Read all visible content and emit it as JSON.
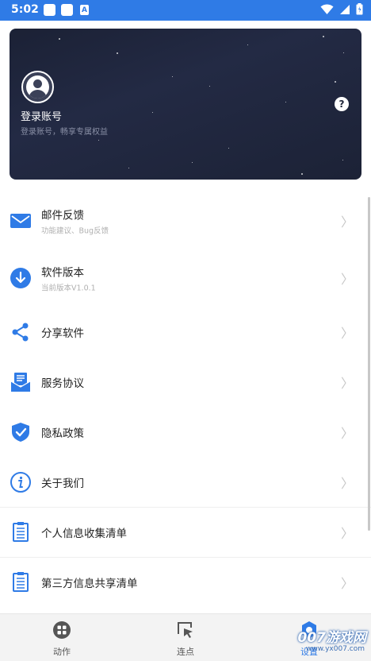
{
  "status_bar": {
    "time": "5:02",
    "notif_letter": "A"
  },
  "header": {
    "login_title": "登录账号",
    "login_subtitle": "登录账号，畅享专属权益",
    "help_label": "?"
  },
  "menu": [
    {
      "title": "邮件反馈",
      "subtitle": "功能建议、Bug反馈",
      "icon": "mail-icon"
    },
    {
      "title": "软件版本",
      "subtitle": "当前版本V1.0.1",
      "icon": "download-icon"
    },
    {
      "title": "分享软件",
      "icon": "share-icon"
    },
    {
      "title": "服务协议",
      "icon": "agreement-icon"
    },
    {
      "title": "隐私政策",
      "icon": "shield-check-icon"
    },
    {
      "title": "关于我们",
      "icon": "info-icon"
    },
    {
      "title": "个人信息收集清单",
      "icon": "clipboard-icon"
    },
    {
      "title": "第三方信息共享清单",
      "icon": "clipboard-icon"
    }
  ],
  "tabs": [
    {
      "label": "动作",
      "icon": "actions-icon"
    },
    {
      "label": "连点",
      "icon": "cursor-click-icon"
    },
    {
      "label": "设置",
      "icon": "settings-icon",
      "active": true
    }
  ],
  "watermark": {
    "main": "007游戏网",
    "url": "www.yx007.com"
  },
  "colors": {
    "accent": "#2f7be6",
    "banner": "#1f2640"
  }
}
